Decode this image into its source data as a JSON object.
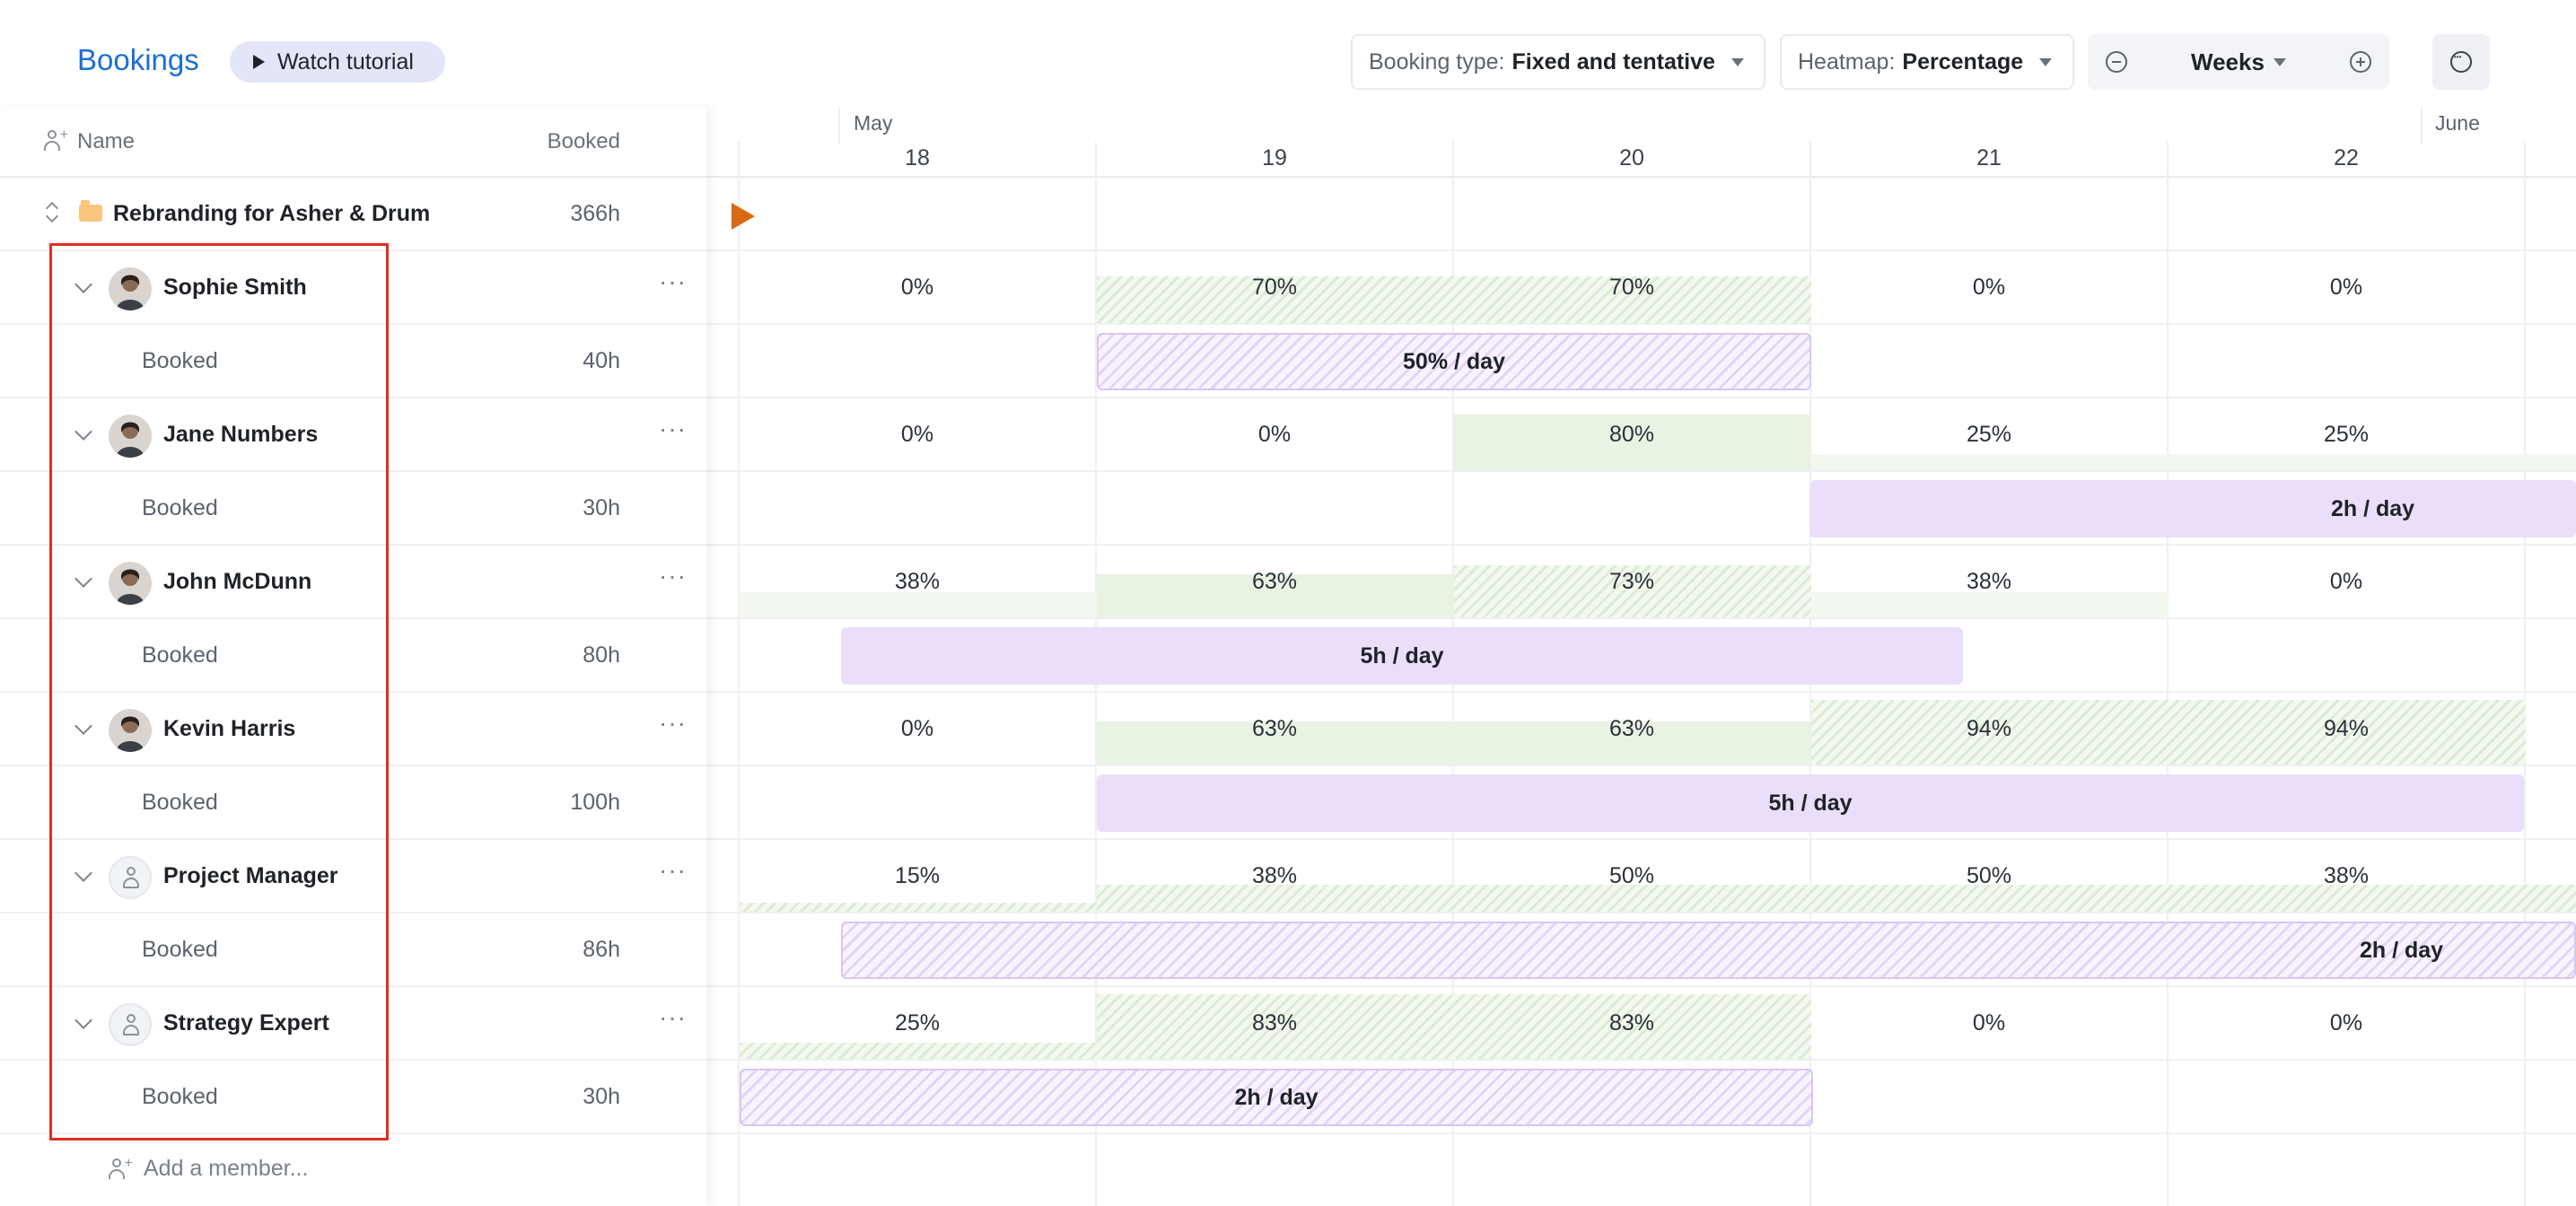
{
  "header": {
    "title": "Bookings",
    "tutorial_label": "Watch tutorial",
    "booking_type": {
      "label": "Booking type:",
      "value": "Fixed and tentative"
    },
    "heatmap": {
      "label": "Heatmap:",
      "value": "Percentage"
    },
    "zoom": {
      "value": "Weeks"
    }
  },
  "columns": {
    "name": "Name",
    "booked": "Booked"
  },
  "project": {
    "name": "Rebranding for Asher & Drum",
    "hours": "366h"
  },
  "members": [
    {
      "name": "Sophie Smith",
      "booked_label": "Booked",
      "hours": "40h",
      "avatar": "photo",
      "pct": [
        "0%",
        "70%",
        "70%",
        "0%",
        "0%"
      ],
      "bar": "50% / day"
    },
    {
      "name": "Jane Numbers",
      "booked_label": "Booked",
      "hours": "30h",
      "avatar": "photo",
      "pct": [
        "0%",
        "0%",
        "80%",
        "25%",
        "25%"
      ],
      "bar": "2h / day"
    },
    {
      "name": "John McDunn",
      "booked_label": "Booked",
      "hours": "80h",
      "avatar": "photo",
      "pct": [
        "38%",
        "63%",
        "73%",
        "38%",
        "0%"
      ],
      "bar": "5h / day"
    },
    {
      "name": "Kevin Harris",
      "booked_label": "Booked",
      "hours": "100h",
      "avatar": "photo",
      "pct": [
        "0%",
        "63%",
        "63%",
        "94%",
        "94%"
      ],
      "bar": "5h / day"
    },
    {
      "name": "Project Manager",
      "booked_label": "Booked",
      "hours": "86h",
      "avatar": "placeholder-person-icon",
      "pct": [
        "15%",
        "38%",
        "50%",
        "50%",
        "38%"
      ],
      "bar": "2h / day"
    },
    {
      "name": "Strategy Expert",
      "booked_label": "Booked",
      "hours": "30h",
      "avatar": "placeholder-person-icon",
      "pct": [
        "25%",
        "83%",
        "83%",
        "0%",
        "0%"
      ],
      "bar": "2h / day"
    }
  ],
  "add_member": "Add a member...",
  "timeline": {
    "months": [
      "May",
      "June"
    ],
    "weeks": [
      "18",
      "19",
      "20",
      "21",
      "22"
    ]
  },
  "colors": {
    "accent": "#1a6fd6",
    "booking_bar": "#ebdefb",
    "heat": "#e9f3e4",
    "selection": "#e02f20",
    "today_marker": "#d96a12"
  }
}
